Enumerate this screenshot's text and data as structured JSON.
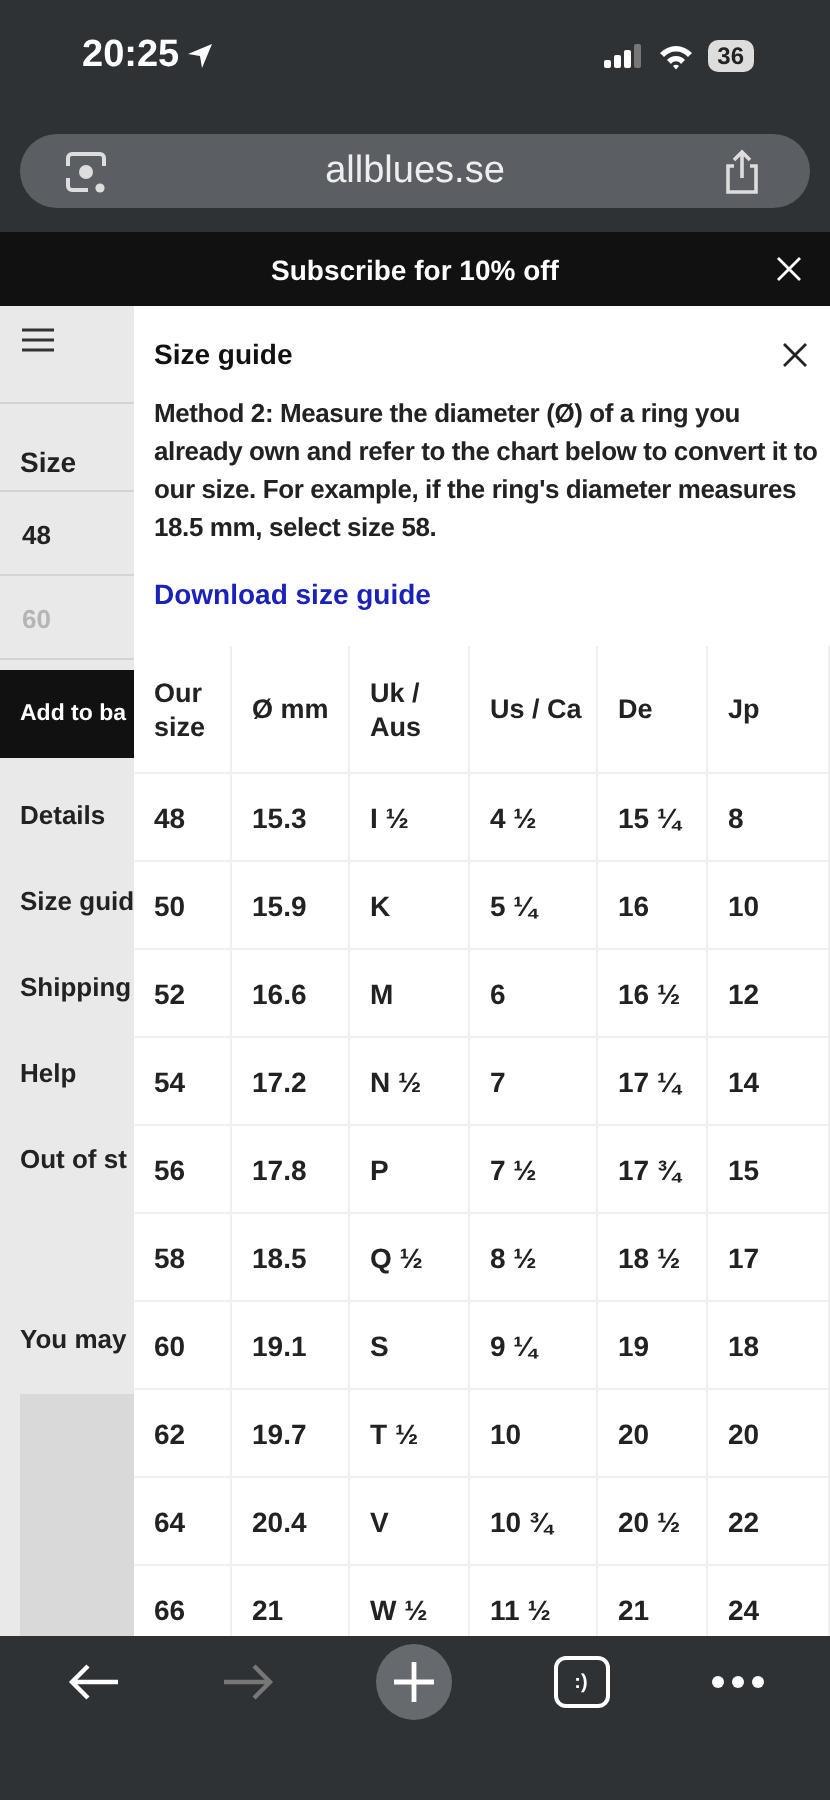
{
  "status_bar": {
    "time": "20:25",
    "battery": "36"
  },
  "address_bar": {
    "url": "allblues.se"
  },
  "banner": {
    "text": "Subscribe for 10% off"
  },
  "page": {
    "size_label": "Size",
    "size_options": [
      {
        "label": "48",
        "disabled": false
      },
      {
        "label": "60",
        "disabled": true
      }
    ],
    "add_button": "Add to ba",
    "links": [
      "Details",
      "Size guid",
      "Shipping",
      "Help",
      "Out of st"
    ],
    "recommend": "You may"
  },
  "size_guide": {
    "title": "Size guide",
    "description": "Method 2: Measure the diameter (Ø) of a ring you already own and refer to the chart below to convert it to our size. For example, if the ring's diameter measures 18.5 mm, select size 58.",
    "download_link": "Download size guide",
    "columns": [
      "Our size",
      "Ø mm",
      "Uk / Aus",
      "Us / Ca",
      "De",
      "Jp"
    ],
    "rows": [
      [
        "48",
        "15.3",
        "I ½",
        "4 ½",
        "15 ¼",
        "8"
      ],
      [
        "50",
        "15.9",
        "K",
        "5 ¼",
        "16",
        "10"
      ],
      [
        "52",
        "16.6",
        "M",
        "6",
        "16 ½",
        "12"
      ],
      [
        "54",
        "17.2",
        "N ½",
        "7",
        "17 ¼",
        "14"
      ],
      [
        "56",
        "17.8",
        "P",
        "7 ½",
        "17 ¾",
        "15"
      ],
      [
        "58",
        "18.5",
        "Q ½",
        "8 ½",
        "18 ½",
        "17"
      ],
      [
        "60",
        "19.1",
        "S",
        "9 ¼",
        "19",
        "18"
      ],
      [
        "62",
        "19.7",
        "T ½",
        "10",
        "20",
        "20"
      ],
      [
        "64",
        "20.4",
        "V",
        "10 ¾",
        "20 ½",
        "22"
      ],
      [
        "66",
        "21",
        "W ½",
        "11 ½",
        "21",
        "24"
      ]
    ]
  },
  "toolbar": {
    "back_disabled": false,
    "forward_disabled": true,
    "tabs_label": ":)"
  }
}
